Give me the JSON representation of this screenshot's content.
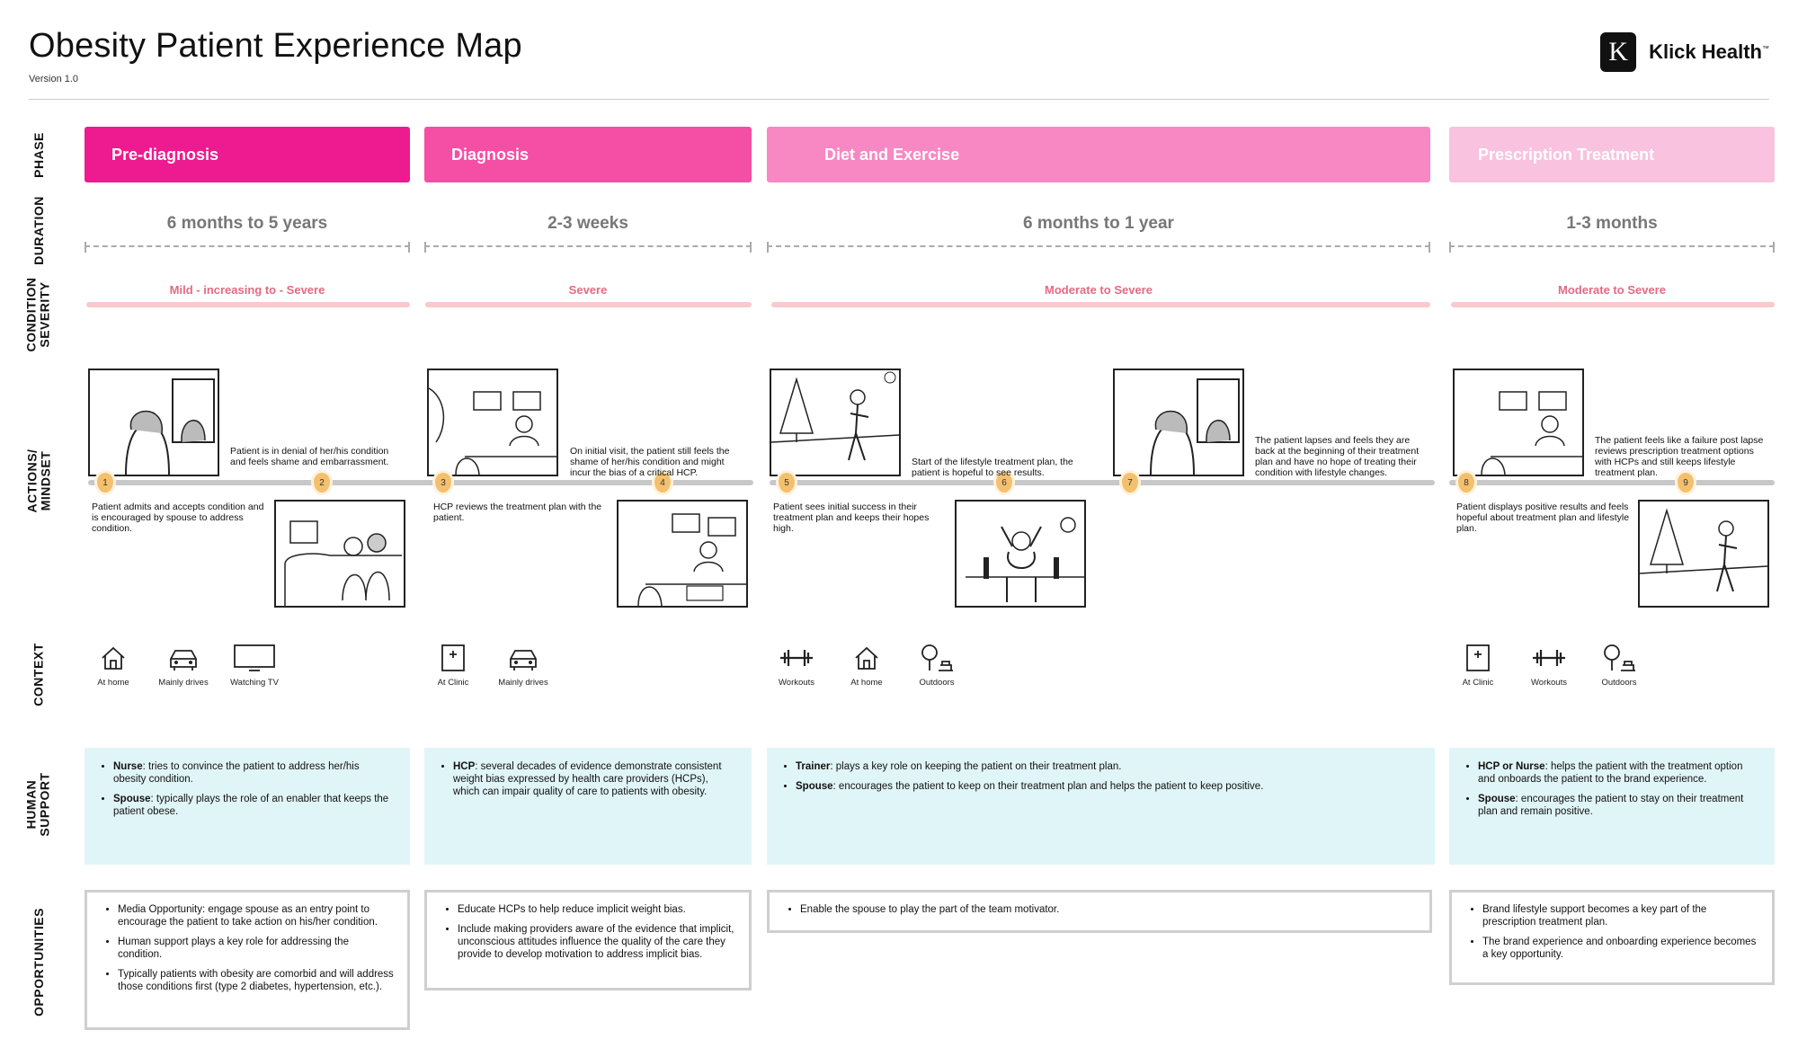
{
  "header": {
    "title": "Obesity Patient Experience Map",
    "version": "Version 1.0",
    "logo_text": "Klick Health",
    "logo_tm": "™"
  },
  "row_labels": {
    "phase": "PHASE",
    "duration": "DURATION",
    "condition": "CONDITION",
    "severity": "SEVERITY",
    "actions": "ACTIONS/",
    "mindset": "MINDSET",
    "context": "CONTEXT",
    "human": "HUMAN",
    "support": "SUPPORT",
    "opportunities": "OPPORTUNITIES"
  },
  "colors": {
    "phase_1": "#ee1a8f",
    "phase_2": "#f44ea5",
    "phase_3": "#f788c3",
    "phase_4": "#f9c2df",
    "severity_text": "#e36a84",
    "severity_bar": "#f8c9cd",
    "support_bg": "#e0f5f7",
    "pin": "#f4c06e"
  },
  "phases": [
    {
      "name": "Pre-diagnosis",
      "duration": "6 months to 5 years",
      "severity": "Mild - increasing to - Severe",
      "support": [
        {
          "role": "Nurse",
          "text": ": tries to convince the patient to address her/his obesity condition."
        },
        {
          "role": "Spouse",
          "text": ": typically plays the role of an enabler that keeps the patient obese."
        }
      ],
      "opportunities": [
        "Media Opportunity: engage spouse as an entry point to encourage the patient to take action on his/her condition.",
        "Human support plays a key role for addressing the condition.",
        "Typically patients with obesity are comorbid and will address those conditions first (type 2 diabetes, hypertension, etc.)."
      ],
      "context": [
        {
          "icon": "home-icon",
          "label": "At home"
        },
        {
          "icon": "car-icon",
          "label": "Mainly drives"
        },
        {
          "icon": "tv-icon",
          "label": "Watching TV"
        }
      ]
    },
    {
      "name": "Diagnosis",
      "duration": "2-3 weeks",
      "severity": "Severe",
      "support": [
        {
          "role": "HCP",
          "text": ":  several decades of evidence demonstrate consistent weight bias expressed by health care providers (HCPs), which can impair quality of care to patients with obesity."
        }
      ],
      "opportunities": [
        "Educate HCPs to help reduce implicit weight bias.",
        "Include making providers aware of the evidence that implicit, unconscious attitudes influence the quality of the care they provide to develop motivation to address implicit bias."
      ],
      "context": [
        {
          "icon": "clinic-icon",
          "label": "At Clinic"
        },
        {
          "icon": "car-icon",
          "label": "Mainly drives"
        }
      ]
    },
    {
      "name": "Diet and Exercise",
      "duration": "6 months to 1 year",
      "severity": "Moderate to Severe",
      "support": [
        {
          "role": "Trainer",
          "text": ": plays a key role on keeping the patient on their treatment plan."
        },
        {
          "role": "Spouse",
          "text": ": encourages the patient to keep on their treatment plan and helps the patient to keep positive."
        }
      ],
      "opportunities": [
        "Enable the spouse to play the part of the team motivator."
      ],
      "context": [
        {
          "icon": "dumbbell-icon",
          "label": "Workouts"
        },
        {
          "icon": "home-icon",
          "label": "At home"
        },
        {
          "icon": "outdoors-icon",
          "label": "Outdoors"
        }
      ]
    },
    {
      "name": "Prescription Treatment",
      "duration": "1-3 months",
      "severity": "Moderate to Severe",
      "support": [
        {
          "role": "HCP or Nurse",
          "text": ": helps the patient with the treatment option and onboards the patient to the brand experience."
        },
        {
          "role": "Spouse",
          "text": ": encourages the patient to stay on their treatment plan and remain positive."
        }
      ],
      "opportunities": [
        "Brand lifestyle support becomes a key part of the prescription treatment plan.",
        "The brand experience and onboarding experience becomes a key opportunity."
      ],
      "context": [
        {
          "icon": "clinic-icon",
          "label": "At Clinic"
        },
        {
          "icon": "dumbbell-icon",
          "label": "Workouts"
        },
        {
          "icon": "outdoors-icon",
          "label": "Outdoors"
        }
      ]
    }
  ],
  "steps": [
    {
      "num": "1",
      "text": "Patient is in denial of her/his condition and feels shame and embarrassment."
    },
    {
      "num": "2",
      "text": "Patient admits and accepts condition and is encouraged by spouse to address condition."
    },
    {
      "num": "3",
      "text": "On initial visit, the patient still feels the shame of her/his condition and might incur the bias of a critical HCP."
    },
    {
      "num": "4",
      "text": "HCP reviews the treatment plan with the patient."
    },
    {
      "num": "5",
      "text": "Start of the lifestyle treatment plan, the patient is hopeful to see results."
    },
    {
      "num": "6",
      "text": "Patient sees initial success in their treatment plan and keeps their hopes high."
    },
    {
      "num": "7",
      "text": "The patient lapses and feels they are back at the beginning of their treatment plan and have no hope of treating their condition with lifestyle changes."
    },
    {
      "num": "8",
      "text": "The patient feels like a failure post lapse reviews prescription treatment options with HCPs and still keeps lifestyle treatment plan."
    },
    {
      "num": "9",
      "text": "Patient displays positive results and feels hopeful about treatment plan and lifestyle plan."
    }
  ]
}
